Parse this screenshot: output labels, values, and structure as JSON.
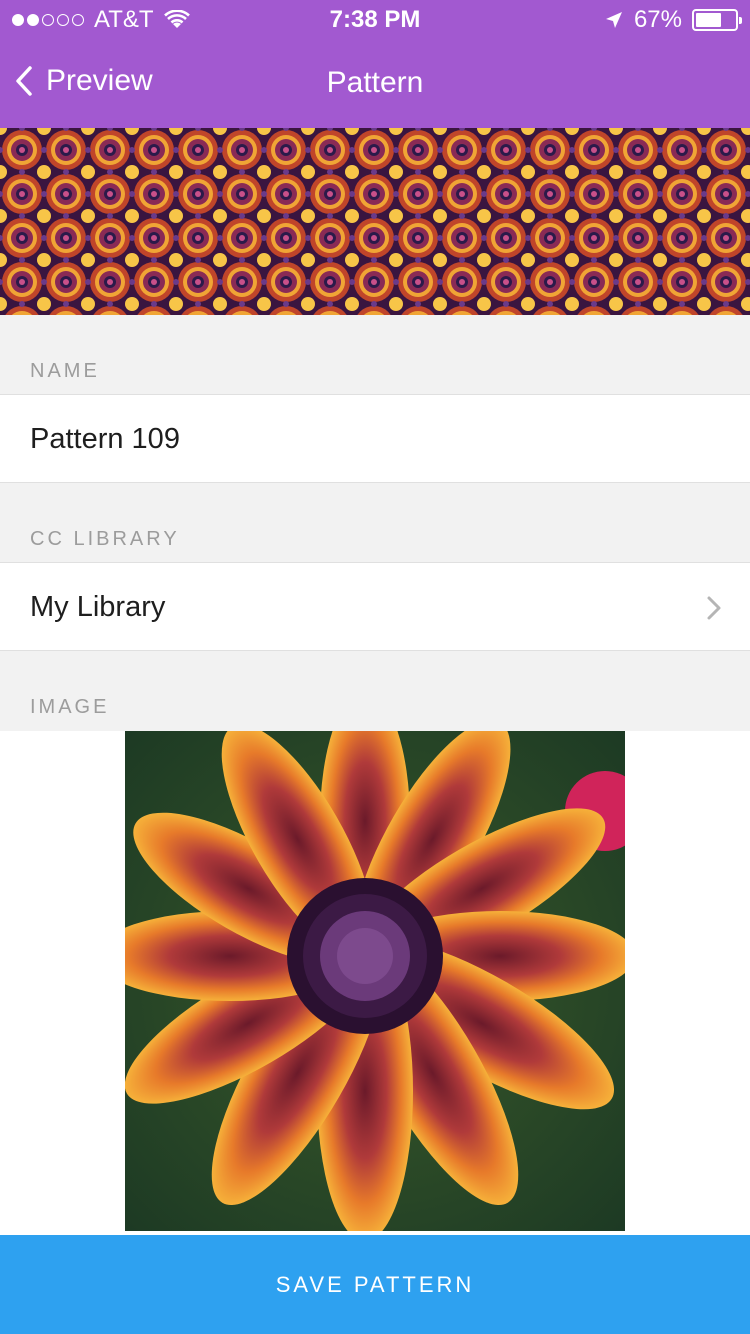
{
  "status_bar": {
    "carrier": "AT&T",
    "time": "7:38 PM",
    "battery": "67%",
    "battery_level": 0.67,
    "signal_bars": 2
  },
  "nav": {
    "back_label": "Preview",
    "title": "Pattern"
  },
  "name_section": {
    "label": "NAME",
    "value": "Pattern 109"
  },
  "library_section": {
    "label": "CC LIBRARY",
    "value": "My Library"
  },
  "image_section": {
    "label": "IMAGE"
  },
  "save_button": {
    "label": "SAVE PATTERN"
  },
  "colors": {
    "header": "#a259d0",
    "save_button": "#2ea1f0"
  }
}
